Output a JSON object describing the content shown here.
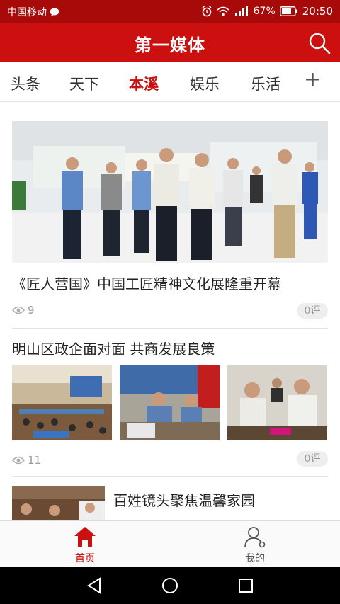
{
  "status": {
    "carrier": "中国移动",
    "battery": "67%",
    "time": "20:50"
  },
  "header": {
    "title": "第一媒体"
  },
  "tabs": [
    {
      "label": "头条",
      "active": false
    },
    {
      "label": "天下",
      "active": false
    },
    {
      "label": "本溪",
      "active": true
    },
    {
      "label": "娱乐",
      "active": false
    },
    {
      "label": "乐活",
      "active": false
    }
  ],
  "tab_add": "+",
  "articles": [
    {
      "title": "《匠人营国》中国工匠精神文化展隆重开幕",
      "views": "9",
      "comments": "0评"
    },
    {
      "title": "明山区政企面对面 共商发展良策",
      "views": "11",
      "comments": "0评"
    },
    {
      "title": "百姓镜头聚焦温馨家园"
    }
  ],
  "nav": {
    "home": "首页",
    "mine": "我的"
  },
  "colors": {
    "brand": "#cc0f0f",
    "status_bar": "#a80a0a"
  }
}
